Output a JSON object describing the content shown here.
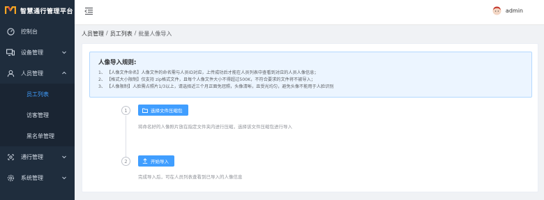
{
  "app": {
    "title": "智慧通行管理平台",
    "logo_icon": "m-logo-icon"
  },
  "sidebar": {
    "items": [
      {
        "label": "控制台",
        "icon": "dashboard-icon"
      },
      {
        "label": "设备管理",
        "icon": "device-icon"
      },
      {
        "label": "人员管理",
        "icon": "user-icon",
        "expanded": true,
        "children": [
          {
            "label": "员工列表",
            "active": true
          },
          {
            "label": "访客管理"
          },
          {
            "label": "黑名单管理"
          }
        ]
      },
      {
        "label": "通行管理",
        "icon": "pass-icon"
      },
      {
        "label": "系统管理",
        "icon": "settings-icon"
      }
    ],
    "active_color": "#409eff",
    "bg_color": "#1f2d3d"
  },
  "header": {
    "user": "admin",
    "menu_icon": "menu-fold-icon",
    "avatar_icon": "avatar-icon"
  },
  "breadcrumb": [
    "人员管理",
    "员工列表",
    "批量人像导入"
  ],
  "rules": {
    "title": "人像导入规则:",
    "lines": [
      {
        "num": "1、",
        "text": "【人像文件命名】人像文件的命名需与人员ID对应，上传成功后才能在人员列表中查看到对应的人员人像信息；"
      },
      {
        "num": "2、",
        "text": "【格式大小限制】仅支持 zip格式文件，且每个人像文件大小不得超过500K，不符合要求的文件将不被导入；"
      },
      {
        "num": "3、",
        "text": "【人像限制】人脸需占照片1/3以上，请选择近三个月正面免冠照，头像清晰，且受光均匀，避免头像不能用于人脸识别"
      }
    ]
  },
  "steps": [
    {
      "num": "1",
      "button": "选择文件压缩包",
      "icon": "folder-icon",
      "desc": "将命名好的人像照片放在指定文件夹内进行压缩，选择该文件压缩包进行导入"
    },
    {
      "num": "2",
      "button": "开始导入",
      "icon": "upload-icon",
      "desc": "完成导入后，可在人员列表查看到已导入的人像信息"
    }
  ],
  "primary_color": "#409eff"
}
